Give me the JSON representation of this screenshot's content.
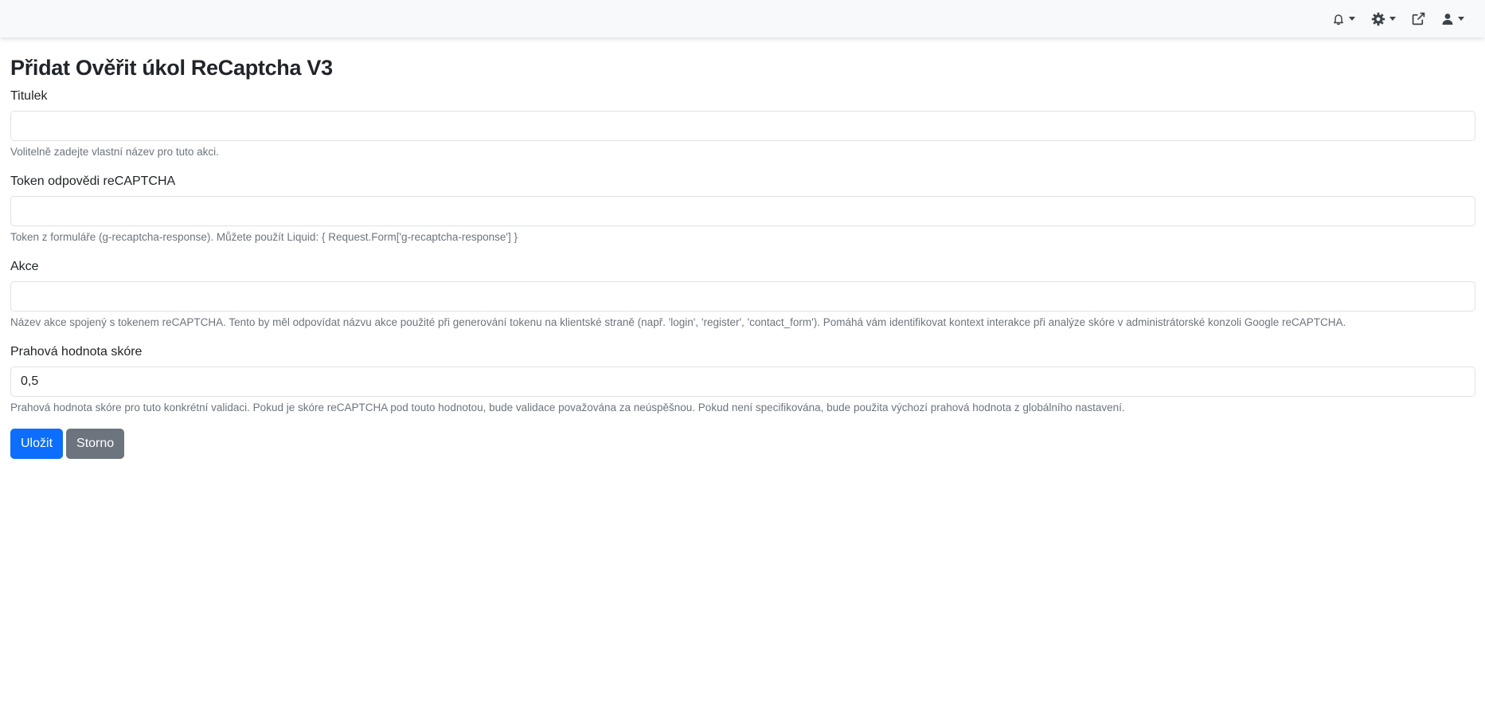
{
  "navbar": {
    "items": [
      {
        "icon": "bell-icon"
      },
      {
        "icon": "gear-icon"
      },
      {
        "icon": "external-link-icon"
      },
      {
        "icon": "user-icon"
      }
    ]
  },
  "page": {
    "title": "Přidat Ověřit úkol ReCaptcha V3"
  },
  "form": {
    "title_field": {
      "label": "Titulek",
      "value": "",
      "help": "Volitelně zadejte vlastní název pro tuto akci."
    },
    "token_field": {
      "label": "Token odpovědi reCAPTCHA",
      "value": "",
      "help": "Token z formuláře (g-recaptcha-response). Můžete použít Liquid: { Request.Form['g-recaptcha-response'] }"
    },
    "action_field": {
      "label": "Akce",
      "value": "",
      "help": "Název akce spojený s tokenem reCAPTCHA. Tento by měl odpovídat názvu akce použité při generování tokenu na klientské straně (např. 'login', 'register', 'contact_form'). Pomáhá vám identifikovat kontext interakce při analýze skóre v administrátorské konzoli Google reCAPTCHA."
    },
    "threshold_field": {
      "label": "Prahová hodnota skóre",
      "value": "0,5",
      "help": "Prahová hodnota skóre pro tuto konkrétní validaci. Pokud je skóre reCAPTCHA pod touto hodnotou, bude validace považována za neúspěšnou. Pokud není specifikována, bude použita výchozí prahová hodnota z globálního nastavení."
    },
    "save_label": "Uložit",
    "cancel_label": "Storno"
  },
  "colors": {
    "primary": "#0d6efd",
    "secondary": "#6c757d",
    "navbar_bg": "#f8f9fa",
    "help_text": "#6c757d"
  }
}
